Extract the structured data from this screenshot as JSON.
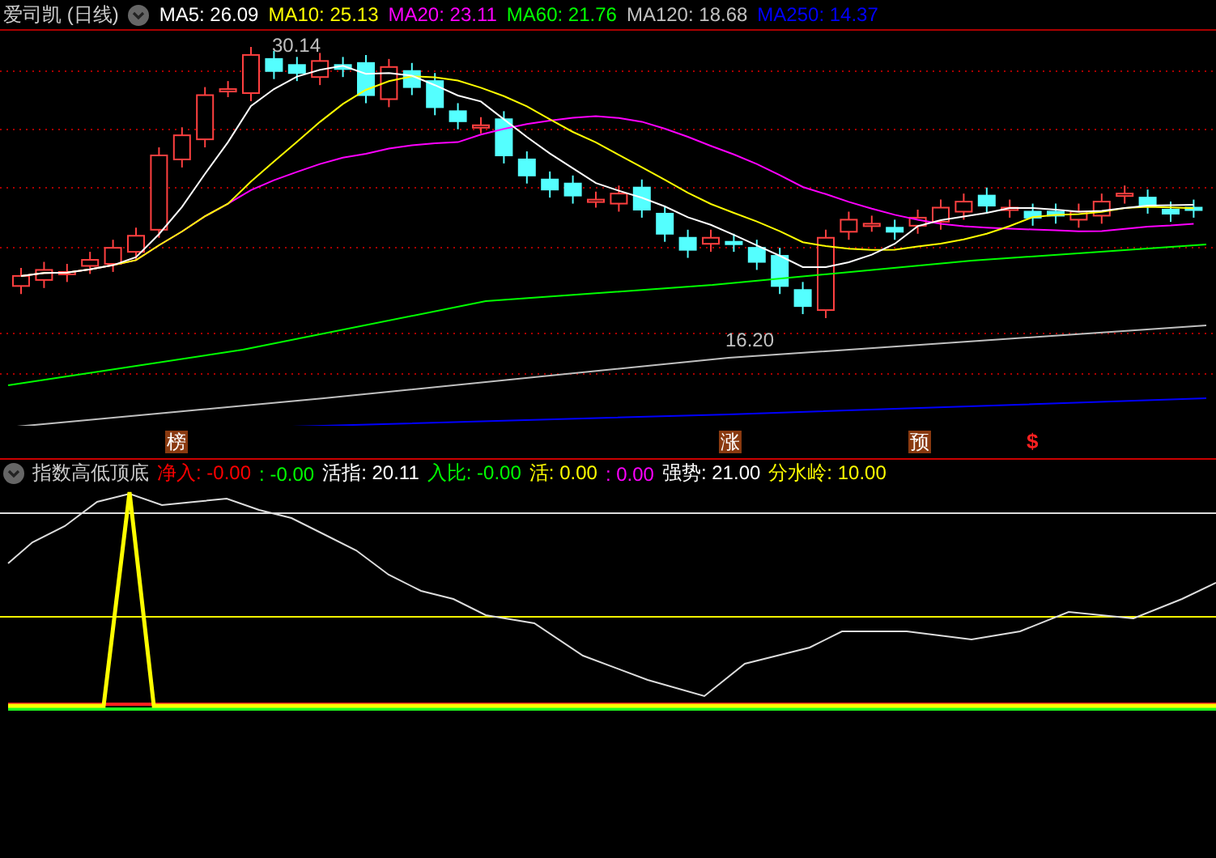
{
  "title": "爱司凯 (日线)",
  "moving_averages": [
    {
      "text": "MA5: 26.09",
      "color": "#ffffff"
    },
    {
      "text": "MA10: 25.13",
      "color": "#ffff00"
    },
    {
      "text": "MA20: 23.11",
      "color": "#ff00ff"
    },
    {
      "text": "MA60: 21.76",
      "color": "#00ff00"
    },
    {
      "text": "MA120: 18.68",
      "color": "#c0c0c0"
    },
    {
      "text": "MA250: 14.37",
      "color": "#0000ff"
    }
  ],
  "price_labels": {
    "high": "30.14",
    "low": "16.20"
  },
  "signals": [
    {
      "text": "榜",
      "kind": "badge"
    },
    {
      "text": "涨",
      "kind": "badge"
    },
    {
      "text": "预",
      "kind": "badge"
    },
    {
      "text": "$",
      "kind": "symbol"
    }
  ],
  "indicator": {
    "name": "指数高低顶底",
    "items": [
      {
        "text": "净入: -0.00",
        "color": "#ff0000"
      },
      {
        "text": ": -0.00",
        "color": "#00ff00"
      },
      {
        "text": "活指: 20.11",
        "color": "#ffffff"
      },
      {
        "text": "入比: -0.00",
        "color": "#00ff00"
      },
      {
        "text": "活: 0.00",
        "color": "#ffff00"
      },
      {
        "text": ": 0.00",
        "color": "#ff00ff"
      },
      {
        "text": "强势: 21.00",
        "color": "#ffffff"
      },
      {
        "text": "分水岭: 10.00",
        "color": "#ffff00"
      }
    ]
  }
}
